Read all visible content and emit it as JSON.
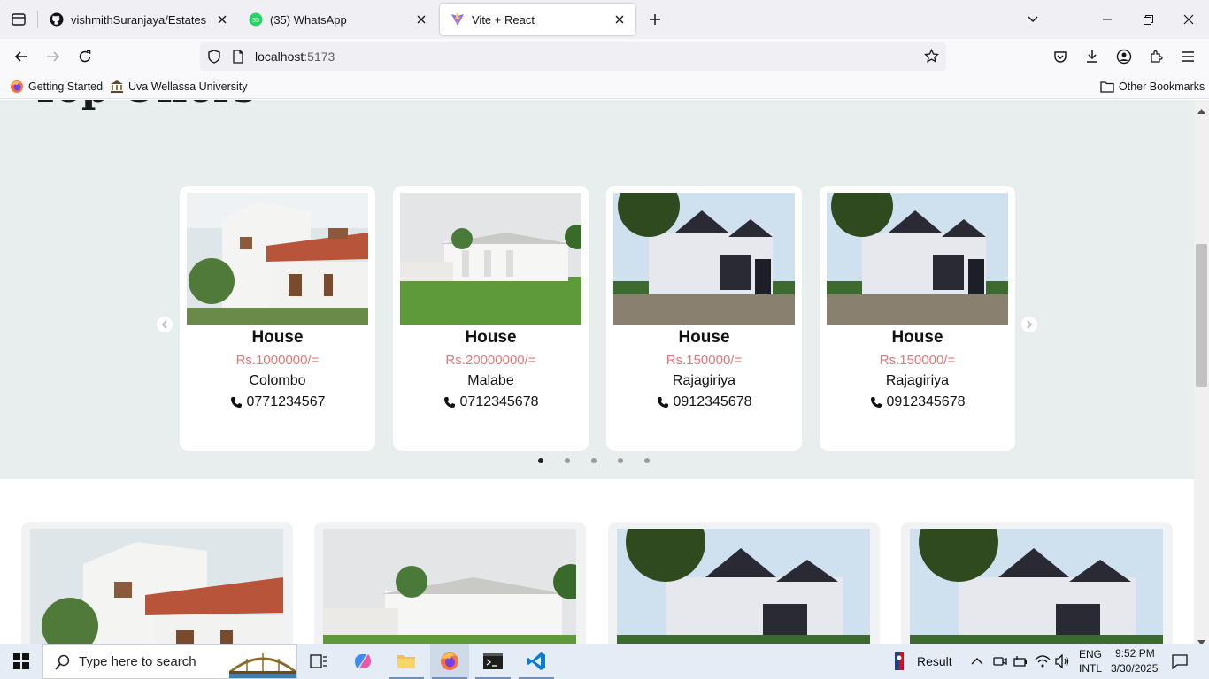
{
  "browser": {
    "tabs": [
      {
        "title": "vishmithSuranjaya/Estates",
        "icon": "github-icon"
      },
      {
        "title": "(35) WhatsApp",
        "icon": "whatsapp-icon",
        "badge": "35"
      },
      {
        "title": "Vite + React",
        "icon": "vite-icon",
        "active": true
      }
    ],
    "url_host": "localhost",
    "url_port": ":5173",
    "bookmarks": [
      {
        "label": "Getting Started",
        "icon": "firefox-icon"
      },
      {
        "label": "Uva Wellassa University",
        "icon": "university-icon"
      }
    ],
    "other_bookmarks": "Other Bookmarks"
  },
  "page": {
    "section_title": "Top Offers",
    "offers": [
      {
        "title": "House",
        "price": "Rs.1000000/=",
        "location": "Colombo",
        "phone": "0771234567",
        "image": "white-two-story-house"
      },
      {
        "title": "House",
        "price": "Rs.20000000/=",
        "location": "Malabe",
        "phone": "0712345678",
        "image": "large-white-mansion-lawn"
      },
      {
        "title": "House",
        "price": "Rs.150000/=",
        "location": "Rajagiriya",
        "phone": "0912345678",
        "image": "modern-white-house-trees"
      },
      {
        "title": "House",
        "price": "Rs.150000/=",
        "location": "Rajagiriya",
        "phone": "0912345678",
        "image": "modern-white-house-trees"
      }
    ],
    "carousel_dots": 5,
    "carousel_active": 0,
    "grid_images": [
      "white-two-story-house",
      "large-white-mansion-lawn",
      "modern-white-house-trees",
      "modern-white-house-trees"
    ],
    "colors": {
      "price": "#e07878",
      "section_bg": "#e8eeed"
    }
  },
  "taskbar": {
    "search_placeholder": "Type here to search",
    "weather_label": "Result",
    "lang_top": "ENG",
    "lang_bottom": "INTL",
    "time": "9:52 PM",
    "date": "3/30/2025"
  }
}
